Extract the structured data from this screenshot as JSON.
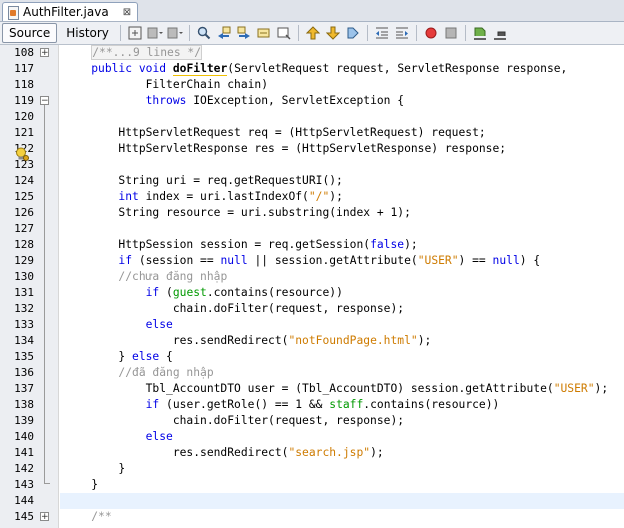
{
  "tab": {
    "filename": "AuthFilter.java",
    "close_glyph": "⊠"
  },
  "toolbar": {
    "source_label": "Source",
    "history_label": "History"
  },
  "editor": {
    "lines": [
      {
        "n": "108",
        "tokens": [
          {
            "t": "    "
          },
          {
            "t": "/**...9 lines */",
            "c": "cm folded"
          }
        ]
      },
      {
        "n": "117",
        "tokens": [
          {
            "t": "    "
          },
          {
            "t": "public",
            "c": "kw"
          },
          {
            "t": " "
          },
          {
            "t": "void",
            "c": "kw"
          },
          {
            "t": " "
          },
          {
            "t": "doFilter",
            "c": "fn uline"
          },
          {
            "t": "(ServletRequest request, ServletResponse response,"
          }
        ]
      },
      {
        "n": "118",
        "tokens": [
          {
            "t": "            FilterChain chain)"
          }
        ]
      },
      {
        "n": "119",
        "tokens": [
          {
            "t": "            "
          },
          {
            "t": "throws",
            "c": "kw"
          },
          {
            "t": " IOException, ServletException {"
          }
        ]
      },
      {
        "n": "120",
        "tokens": [
          {
            "t": ""
          }
        ]
      },
      {
        "n": "121",
        "tokens": [
          {
            "t": "        HttpServletRequest req = (HttpServletRequest) request;"
          }
        ]
      },
      {
        "n": "122",
        "tokens": [
          {
            "t": "        HttpServletResponse res = (HttpServletResponse) response;"
          }
        ]
      },
      {
        "n": "123",
        "tokens": [
          {
            "t": ""
          }
        ]
      },
      {
        "n": "124",
        "tokens": [
          {
            "t": "        String uri = req.getRequestURI();"
          }
        ]
      },
      {
        "n": "125",
        "tokens": [
          {
            "t": "        "
          },
          {
            "t": "int",
            "c": "kw"
          },
          {
            "t": " index = uri.lastIndexOf("
          },
          {
            "t": "\"/\"",
            "c": "str"
          },
          {
            "t": ");"
          }
        ]
      },
      {
        "n": "126",
        "tokens": [
          {
            "t": "        String resource = uri.substring(index + 1);"
          }
        ]
      },
      {
        "n": "127",
        "tokens": [
          {
            "t": ""
          }
        ]
      },
      {
        "n": "128",
        "tokens": [
          {
            "t": "        HttpSession session = req.getSession("
          },
          {
            "t": "false",
            "c": "kw"
          },
          {
            "t": ");"
          }
        ]
      },
      {
        "n": "129",
        "tokens": [
          {
            "t": "        "
          },
          {
            "t": "if",
            "c": "kw"
          },
          {
            "t": " (session == "
          },
          {
            "t": "null",
            "c": "kw"
          },
          {
            "t": " || session.getAttribute("
          },
          {
            "t": "\"USER\"",
            "c": "str"
          },
          {
            "t": ") == "
          },
          {
            "t": "null",
            "c": "kw"
          },
          {
            "t": ") {"
          }
        ]
      },
      {
        "n": "130",
        "tokens": [
          {
            "t": "        "
          },
          {
            "t": "//chưa đăng nhập",
            "c": "cm"
          }
        ]
      },
      {
        "n": "131",
        "tokens": [
          {
            "t": "            "
          },
          {
            "t": "if",
            "c": "kw"
          },
          {
            "t": " ("
          },
          {
            "t": "guest",
            "c": "fld"
          },
          {
            "t": ".contains(resource))"
          }
        ]
      },
      {
        "n": "132",
        "tokens": [
          {
            "t": "                chain.doFilter(request, response);"
          }
        ]
      },
      {
        "n": "133",
        "tokens": [
          {
            "t": "            "
          },
          {
            "t": "else",
            "c": "kw"
          }
        ]
      },
      {
        "n": "134",
        "tokens": [
          {
            "t": "                res.sendRedirect("
          },
          {
            "t": "\"notFoundPage.html\"",
            "c": "str"
          },
          {
            "t": ");"
          }
        ]
      },
      {
        "n": "135",
        "tokens": [
          {
            "t": "        } "
          },
          {
            "t": "else",
            "c": "kw"
          },
          {
            "t": " {"
          }
        ]
      },
      {
        "n": "136",
        "tokens": [
          {
            "t": "        "
          },
          {
            "t": "//đã đăng nhập",
            "c": "cm"
          }
        ]
      },
      {
        "n": "137",
        "tokens": [
          {
            "t": "            Tbl_AccountDTO user = (Tbl_AccountDTO) session.getAttribute("
          },
          {
            "t": "\"USER\"",
            "c": "str"
          },
          {
            "t": ");"
          }
        ]
      },
      {
        "n": "138",
        "tokens": [
          {
            "t": "            "
          },
          {
            "t": "if",
            "c": "kw"
          },
          {
            "t": " (user.getRole() == 1 && "
          },
          {
            "t": "staff",
            "c": "fld"
          },
          {
            "t": ".contains(resource))"
          }
        ]
      },
      {
        "n": "139",
        "tokens": [
          {
            "t": "                chain.doFilter(request, response);"
          }
        ]
      },
      {
        "n": "140",
        "tokens": [
          {
            "t": "            "
          },
          {
            "t": "else",
            "c": "kw"
          }
        ]
      },
      {
        "n": "141",
        "tokens": [
          {
            "t": "                res.sendRedirect("
          },
          {
            "t": "\"search.jsp\"",
            "c": "str"
          },
          {
            "t": ");"
          }
        ]
      },
      {
        "n": "142",
        "tokens": [
          {
            "t": "        }"
          }
        ]
      },
      {
        "n": "143",
        "tokens": [
          {
            "t": "    }"
          }
        ]
      },
      {
        "n": "144",
        "tokens": [
          {
            "t": ""
          }
        ]
      },
      {
        "n": "145",
        "tokens": [
          {
            "t": "    "
          },
          {
            "t": "/**",
            "c": "cm"
          }
        ]
      }
    ]
  }
}
